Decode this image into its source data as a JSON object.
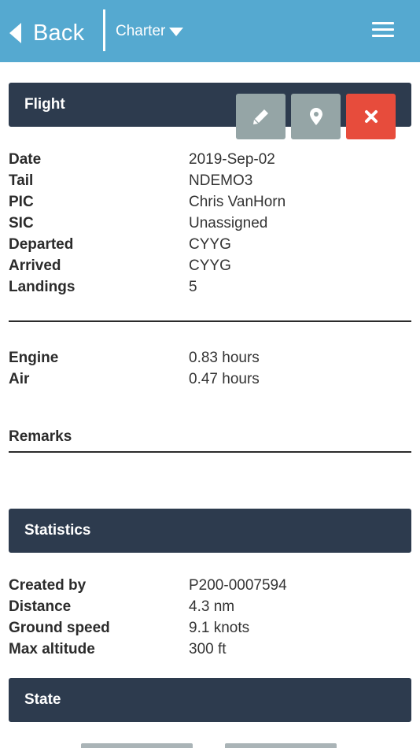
{
  "header": {
    "back_label": "Back",
    "dropdown_label": "Charter",
    "colors": {
      "bar": "#55a9d0"
    }
  },
  "flight": {
    "title": "Flight",
    "actions": [
      {
        "name": "edit",
        "icon": "pencil-icon",
        "color": "#95a5a6"
      },
      {
        "name": "map",
        "icon": "map-pin-icon",
        "color": "#95a5a6"
      },
      {
        "name": "delete",
        "icon": "close-icon",
        "color": "#e74c3c"
      }
    ],
    "rows": [
      {
        "label": "Date",
        "value": "2019-Sep-02"
      },
      {
        "label": "Tail",
        "value": "NDEMO3"
      },
      {
        "label": "PIC",
        "value": "Chris VanHorn"
      },
      {
        "label": "SIC",
        "value": "Unassigned"
      },
      {
        "label": "Departed",
        "value": "CYYG"
      },
      {
        "label": "Arrived",
        "value": "CYYG"
      },
      {
        "label": "Landings",
        "value": "5"
      }
    ],
    "times": [
      {
        "label": "Engine",
        "value": "0.83 hours"
      },
      {
        "label": "Air",
        "value": "0.47 hours"
      }
    ],
    "remarks_label": "Remarks"
  },
  "statistics": {
    "title": "Statistics",
    "rows": [
      {
        "label": "Created by",
        "value": "P200-0007594"
      },
      {
        "label": "Distance",
        "value": "4.3 nm"
      },
      {
        "label": "Ground speed",
        "value": "9.1 knots"
      },
      {
        "label": "Max altitude",
        "value": "300 ft"
      }
    ]
  },
  "state": {
    "title": "State"
  }
}
